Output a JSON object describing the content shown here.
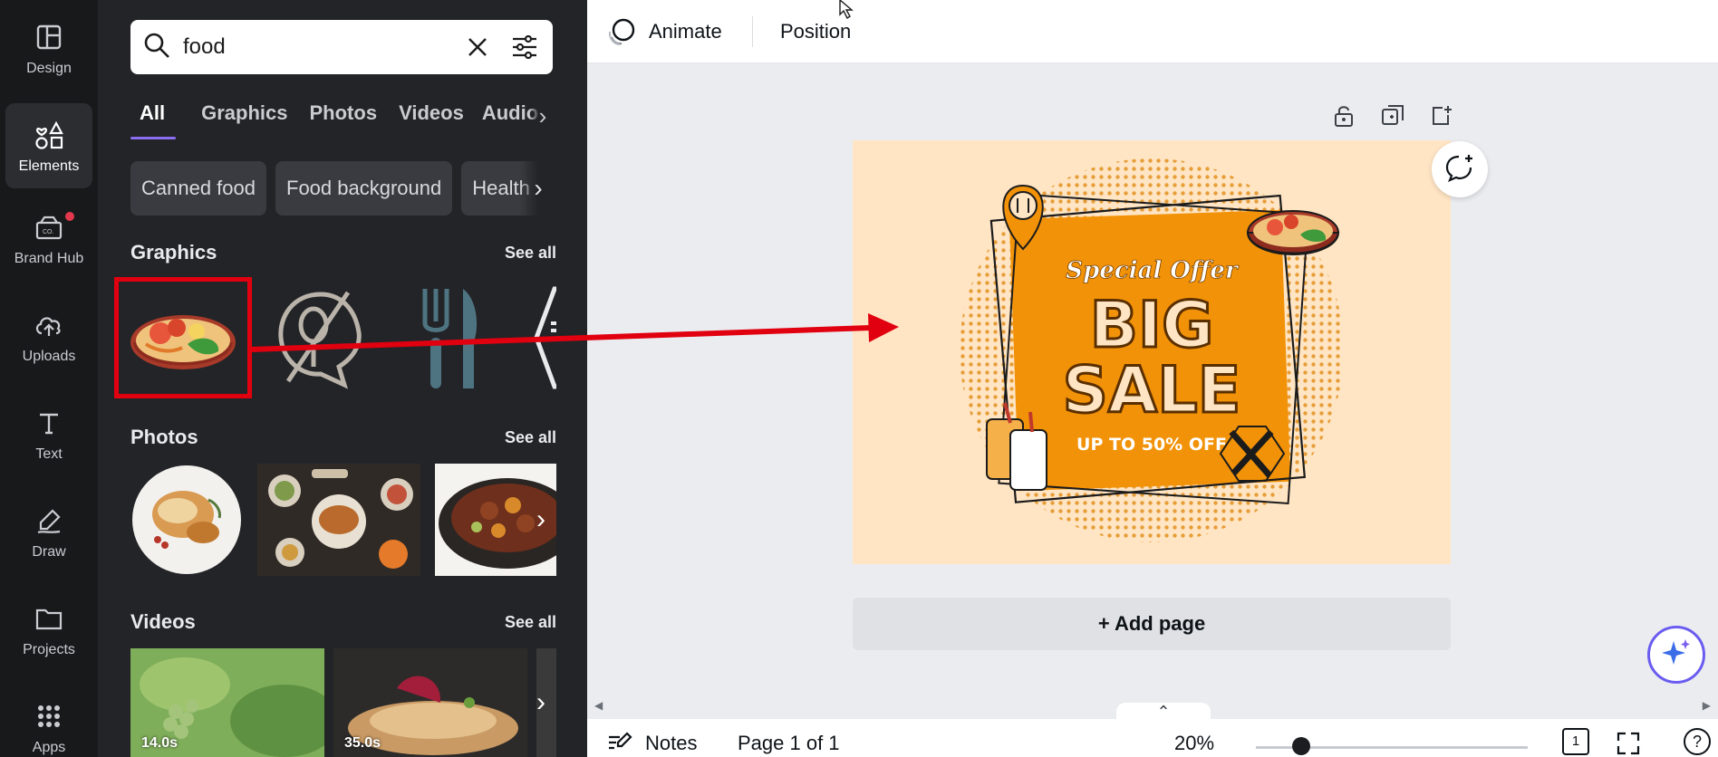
{
  "rail": {
    "items": [
      {
        "label": "Design"
      },
      {
        "label": "Elements"
      },
      {
        "label": "Brand Hub"
      },
      {
        "label": "Uploads"
      },
      {
        "label": "Text"
      },
      {
        "label": "Draw"
      },
      {
        "label": "Projects"
      },
      {
        "label": "Apps"
      }
    ]
  },
  "search": {
    "value": "food"
  },
  "tabs": [
    "All",
    "Graphics",
    "Photos",
    "Videos",
    "Audio"
  ],
  "chips": [
    "Canned food",
    "Food background",
    "Health"
  ],
  "graphics": {
    "title": "Graphics",
    "see_all": "See all"
  },
  "photos": {
    "title": "Photos",
    "see_all": "See all"
  },
  "videos": {
    "title": "Videos",
    "see_all": "See all",
    "durations": [
      "14.0s",
      "35.0s"
    ]
  },
  "toolbar": {
    "animate": "Animate",
    "position": "Position"
  },
  "design": {
    "special_offer": "Special Offer",
    "big": "BIG",
    "sale": "SALE",
    "discount": "UP TO 50% OFF"
  },
  "add_page": "+ Add page",
  "bottom": {
    "notes": "Notes",
    "page": "Page 1 of 1",
    "zoom": "20%",
    "page_count": "1",
    "help": "?"
  },
  "colors": {
    "accent": "#8b6df0",
    "highlight_red": "#e1000f",
    "sale_orange": "#f29208",
    "canvas_bg": "#ffe5c4"
  }
}
